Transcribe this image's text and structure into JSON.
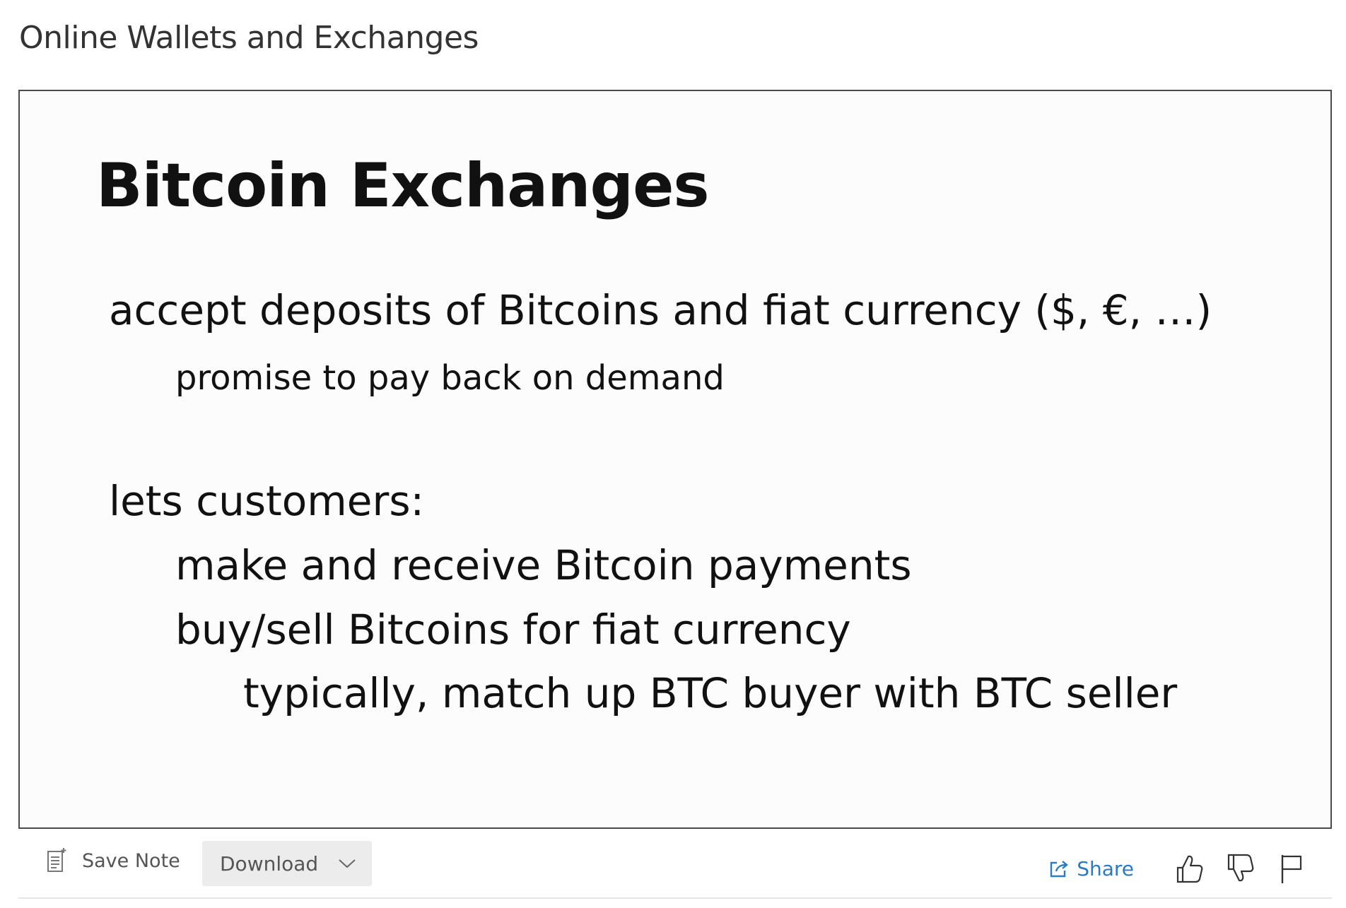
{
  "page": {
    "title": "Online Wallets and Exchanges"
  },
  "slide": {
    "heading": "Bitcoin Exchanges",
    "bullets": [
      {
        "level": 1,
        "text": "accept deposits of Bitcoins and fiat currency ($, €, …)"
      },
      {
        "level": 2,
        "text": "promise to pay back on demand"
      },
      {
        "level": 1,
        "text": "lets customers:"
      },
      {
        "level": 2,
        "text": "make and receive Bitcoin payments"
      },
      {
        "level": 2,
        "text": "buy/sell Bitcoins for fiat currency"
      },
      {
        "level": 3,
        "text": "typically, match up BTC buyer with BTC seller"
      }
    ]
  },
  "toolbar": {
    "save_note_label": "Save Note",
    "save_note_icon": "note-icon",
    "download_label": "Download",
    "download_icon": "chevron-down-icon",
    "share_label": "Share",
    "share_icon": "share-icon",
    "like_icon": "thumbs-up-icon",
    "dislike_icon": "thumbs-down-icon",
    "flag_icon": "flag-icon"
  },
  "colors": {
    "share_link": "#2a7bc4",
    "download_bg": "#ececec",
    "slide_border": "#4a4a4a"
  }
}
